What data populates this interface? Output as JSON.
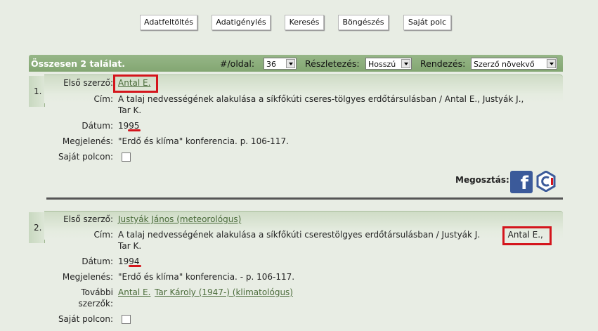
{
  "nav": {
    "buttons": [
      "Adatfeltöltés",
      "Adatigénylés",
      "Keresés",
      "Böngészés",
      "Saját polc"
    ]
  },
  "results_header": {
    "total": "Összesen 2 találat.",
    "per_page_label": "#/oldal:",
    "per_page_value": "36",
    "detail_label": "Részletezés:",
    "detail_value": "Hosszú",
    "sort_label": "Rendezés:",
    "sort_value": "Szerző növekvő"
  },
  "labels": {
    "first_author": "Első szerző:",
    "title": "Cím:",
    "date": "Dátum:",
    "publication": "Megjelenés:",
    "own_shelf": "Saját polcon:",
    "other_authors_1": "További",
    "other_authors_2": "szerzők:",
    "share": "Megosztás:"
  },
  "records": [
    {
      "number": "1.",
      "first_author": "Antal E.",
      "title_line1": "A talaj nedvességének alakulása a síkfőkúti cseres-tölgyes erdőtársulásban / Antal E., Justyák J.,",
      "title_line2": "Tar K.",
      "date": "1995",
      "publication": "\"Erdő és klíma\" konferencia. p. 106-117."
    },
    {
      "number": "2.",
      "first_author": "Justyák János (meteorológus)",
      "title_line1a": "A talaj nedvességének alakulása a síkfőkúti cserestölgyes erdőtársulásban / Justyák J.",
      "title_line1b": ", Antal E.,",
      "title_line2": "Tar K.",
      "date": "1994",
      "publication": "\"Erdő és klíma\" konferencia. - p. 106-117.",
      "other_authors": [
        "Antal E.",
        "Tar Károly (1947-) (klimatológus)"
      ]
    }
  ],
  "icons": {
    "facebook": "facebook-icon",
    "share2": "share-service-icon"
  },
  "colors": {
    "header": "#8aab79",
    "highlight": "#d4151c",
    "link": "#4a6b3a"
  }
}
